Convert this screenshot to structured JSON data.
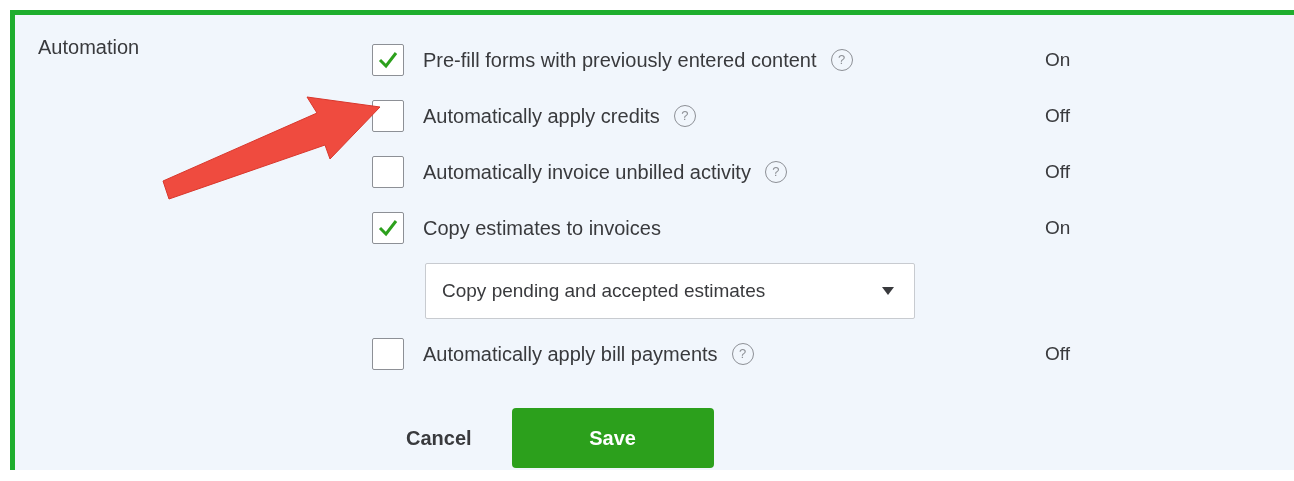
{
  "section": {
    "title": "Automation",
    "items": [
      {
        "kind": "checkbox",
        "label": "Pre-fill forms with previously entered content",
        "help": "?",
        "checked": true,
        "status": "On"
      },
      {
        "kind": "checkbox",
        "label": "Automatically apply credits",
        "help": "?",
        "checked": false,
        "status": "Off"
      },
      {
        "kind": "checkbox",
        "label": "Automatically invoice unbilled activity",
        "help": "?",
        "checked": false,
        "status": "Off"
      },
      {
        "kind": "checkbox",
        "label": "Copy estimates to invoices",
        "checked": true,
        "status": "On"
      },
      {
        "kind": "dropdown",
        "value": "Copy pending and accepted estimates"
      },
      {
        "kind": "checkbox",
        "label": "Automatically apply bill payments",
        "help": "?",
        "checked": false,
        "status": "Off"
      }
    ]
  },
  "buttons": {
    "cancel": "Cancel",
    "save": "Save"
  }
}
